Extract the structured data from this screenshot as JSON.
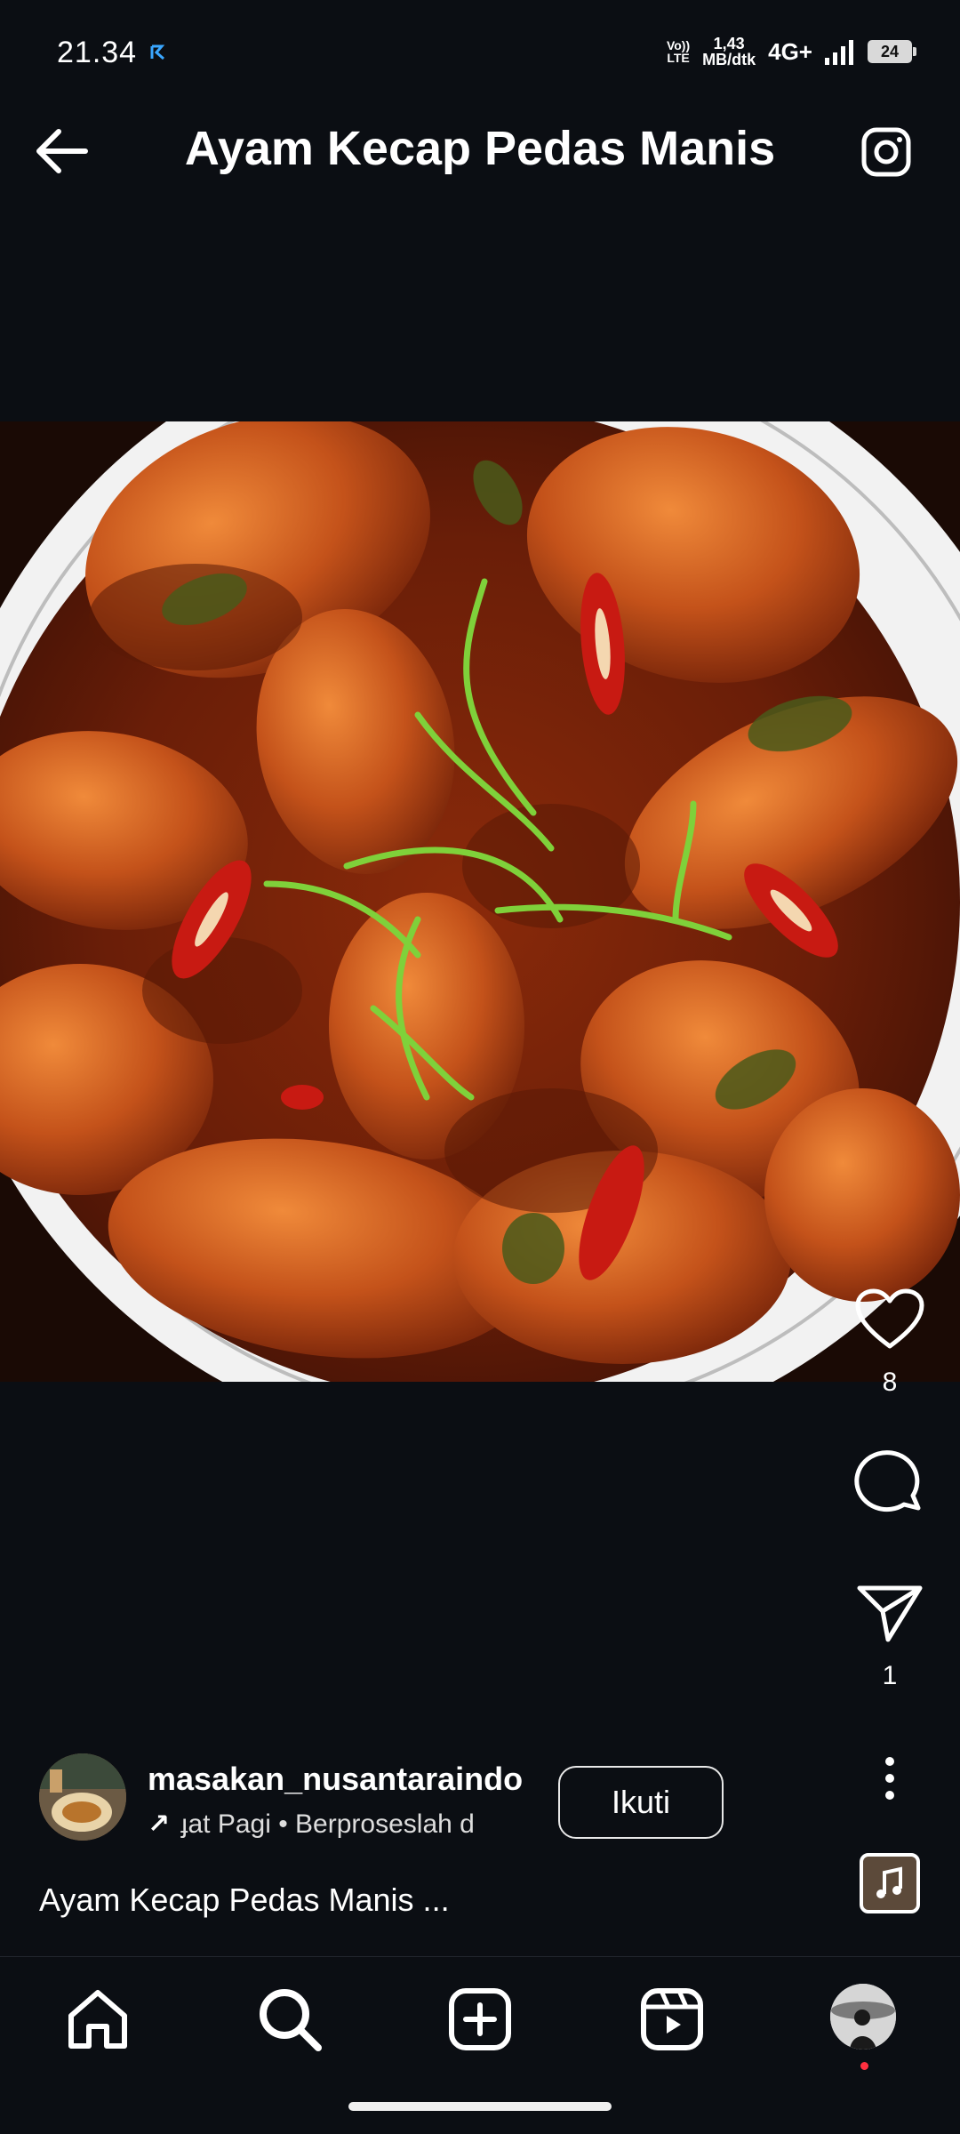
{
  "status_bar": {
    "time": "21.34",
    "volte_top": "Vo))",
    "volte_bottom": "LTE",
    "net_speed_top": "1,43",
    "net_speed_bottom": "MB/dtk",
    "network": "4G+",
    "battery": "24"
  },
  "header": {
    "title": "Ayam Kecap Pedas Manis",
    "back_icon": "arrow-left-icon",
    "camera_icon": "camera-icon"
  },
  "post": {
    "image_subject": "food-photo",
    "likes": "8",
    "shares": "1",
    "author": {
      "username": "masakan_nusantaraindo",
      "music_text": "ɟat Pagi • Berproseslah d",
      "follow_label": "Ikuti"
    },
    "caption": "Ayam Kecap Pedas Manis ..."
  },
  "colors": {
    "background": "#0b0e13",
    "text": "#ffffff",
    "notification_dot": "#ff3040"
  }
}
